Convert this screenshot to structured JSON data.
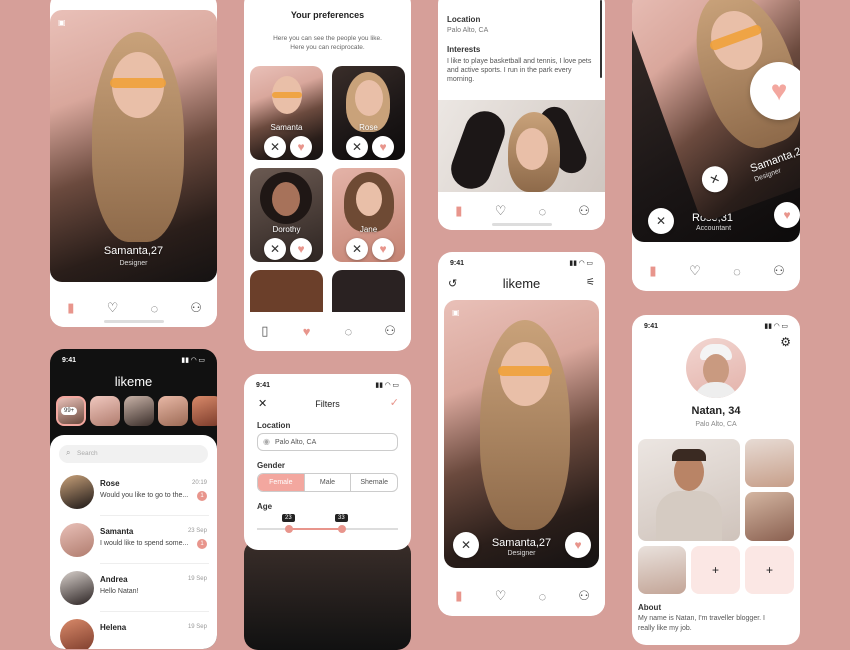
{
  "screen1": {
    "name": "Samanta,27",
    "role": "Designer"
  },
  "prefs": {
    "title": "Your preferences",
    "subtitle_line1": "Here you can see the people you like.",
    "subtitle_line2": "Here you can reciprocate.",
    "cards": [
      {
        "name": "Samanta"
      },
      {
        "name": "Rose"
      },
      {
        "name": "Dorothy"
      },
      {
        "name": "Jane"
      }
    ]
  },
  "details": {
    "location_label": "Location",
    "location_value": "Palo Alto, CA",
    "interests_label": "Interests",
    "interests_text": "I like to playe basketball and tennis, I love pets and active sports. I run in the park every morning."
  },
  "stack": {
    "top_name": "Samanta,27",
    "top_role": "Designer",
    "back_name": "Rose,31",
    "back_role": "Accountant"
  },
  "chat": {
    "time": "9:41",
    "title": "likeme",
    "story_badge": "99+",
    "search_placeholder": "Search",
    "messages": [
      {
        "name": "Rose",
        "text": "Would you like to go to the...",
        "time": "20:19",
        "badge": "1"
      },
      {
        "name": "Samanta",
        "text": "I would like to spend some...",
        "time": "23 Sep",
        "badge": "1"
      },
      {
        "name": "Andrea",
        "text": "Hello Natan!",
        "time": "19 Sep",
        "badge": ""
      },
      {
        "name": "Helena",
        "text": "",
        "time": "19 Sep",
        "badge": ""
      }
    ]
  },
  "filters": {
    "time": "9:41",
    "title": "Filters",
    "location_label": "Location",
    "location_value": "Palo Alto, CA",
    "gender_label": "Gender",
    "genders": [
      "Female",
      "Male",
      "Shemale"
    ],
    "age_label": "Age",
    "age_min": "23",
    "age_max": "33"
  },
  "main": {
    "time": "9:41",
    "title": "likeme",
    "name": "Samanta,27",
    "role": "Designer"
  },
  "profile": {
    "time": "9:41",
    "name": "Natan, 34",
    "location": "Palo Alto, CA",
    "about_label": "About",
    "about_text_line1": "My name is Natan, I'm traveller blogger. I",
    "about_text_line2": "really like my job.",
    "add_label": "+"
  },
  "colors": {
    "accent": "#e8958c",
    "background": "#d69f99"
  }
}
